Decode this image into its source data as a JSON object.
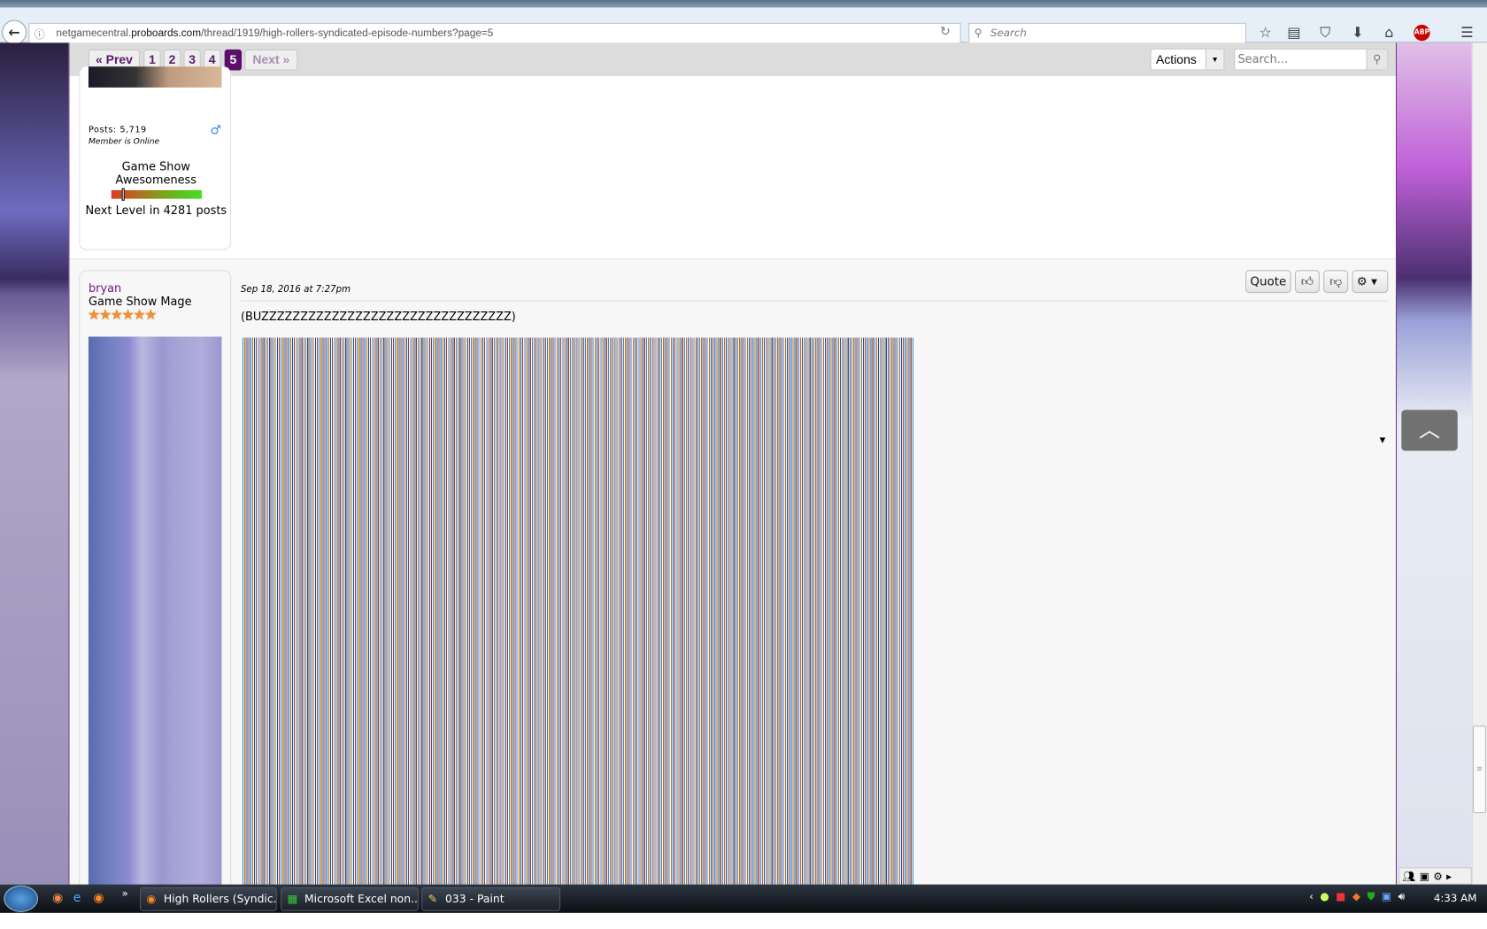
{
  "browser": {
    "url_domain_prefix": "netgamecentral.",
    "url_domain": "proboards.com",
    "url_path": "/thread/1919/high-rollers-syndicated-episode-numbers?page=5",
    "search_placeholder": "Search",
    "back_icon": "back-arrow-icon",
    "toolbar_icons": [
      "star-icon",
      "clipboard-icon",
      "pocket-icon",
      "download-icon",
      "home-icon",
      "adblock-icon",
      "menu-icon"
    ],
    "adblock_label": "ABP"
  },
  "pagination": {
    "prev": "« Prev",
    "pages": [
      "1",
      "2",
      "3",
      "4",
      "5"
    ],
    "current": "5",
    "next": "Next »",
    "actions": "Actions",
    "search_placeholder": "Search..."
  },
  "post1": {
    "posts": "Posts: 5,719",
    "status": "Member is Online",
    "level_title": "Game Show Awesomeness",
    "level_progress": 0.13,
    "next_level": "Next Level in 4281 posts"
  },
  "post2": {
    "username": "bryan",
    "rank": "Game Show Mage",
    "stars": "★★★★★★",
    "star_count": 6,
    "date": "Sep 18, 2016 at 7:27pm",
    "message": "(BUZZZZZZZZZZZZZZZZZZZZZZZZZZZZZZZZ)",
    "quote": "Quote"
  },
  "taskbar": {
    "tasks": [
      "High Rollers (Syndic...",
      "Microsoft Excel non...",
      "033 - Paint"
    ],
    "clock": "4:33 AM"
  },
  "colors": {
    "accent": "#5a0f6a",
    "link": "#6a1a7a"
  }
}
